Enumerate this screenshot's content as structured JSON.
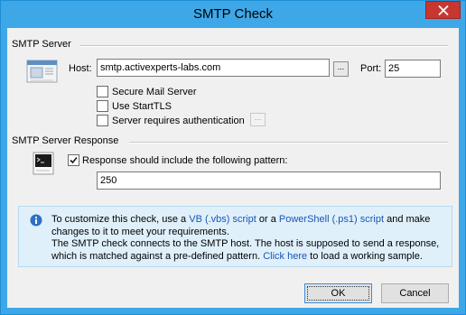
{
  "window": {
    "title": "SMTP Check"
  },
  "colors": {
    "titlebar": "#3ea7e8",
    "close": "#c7372f",
    "link": "#1a55b7",
    "info_bg": "#dff0fb"
  },
  "server_group": {
    "label": "SMTP Server",
    "host_label": "Host:",
    "host_value": "smtp.activexperts-labs.com",
    "browse_label": "...",
    "port_label": "Port:",
    "port_value": "25",
    "secure_mail": {
      "label": "Secure Mail Server",
      "checked": false
    },
    "starttls": {
      "label": "Use StartTLS",
      "checked": false
    },
    "auth": {
      "label": "Server requires authentication",
      "checked": false
    },
    "auth_button_label": "...",
    "icon": "mail-server-icon"
  },
  "response_group": {
    "label": "SMTP Server Response",
    "icon": "terminal-icon",
    "pattern_checkbox": {
      "label": "Response should include the following pattern:",
      "checked": true
    },
    "pattern_value": "250"
  },
  "info": {
    "icon": "info-icon",
    "t1": "To customize this check, use a ",
    "vb_link": "VB (.vbs) script",
    "t2": " or a ",
    "ps_link": "PowerShell (.ps1) script",
    "t3": " and make changes to it to meet your requirements.",
    "t4": "The SMTP check connects to the SMTP host. The host is supposed to send a response, which is matched against a pre-defined pattern. ",
    "click_link": "Click here",
    "t5": " to load a working sample."
  },
  "buttons": {
    "ok": "OK",
    "cancel": "Cancel"
  }
}
